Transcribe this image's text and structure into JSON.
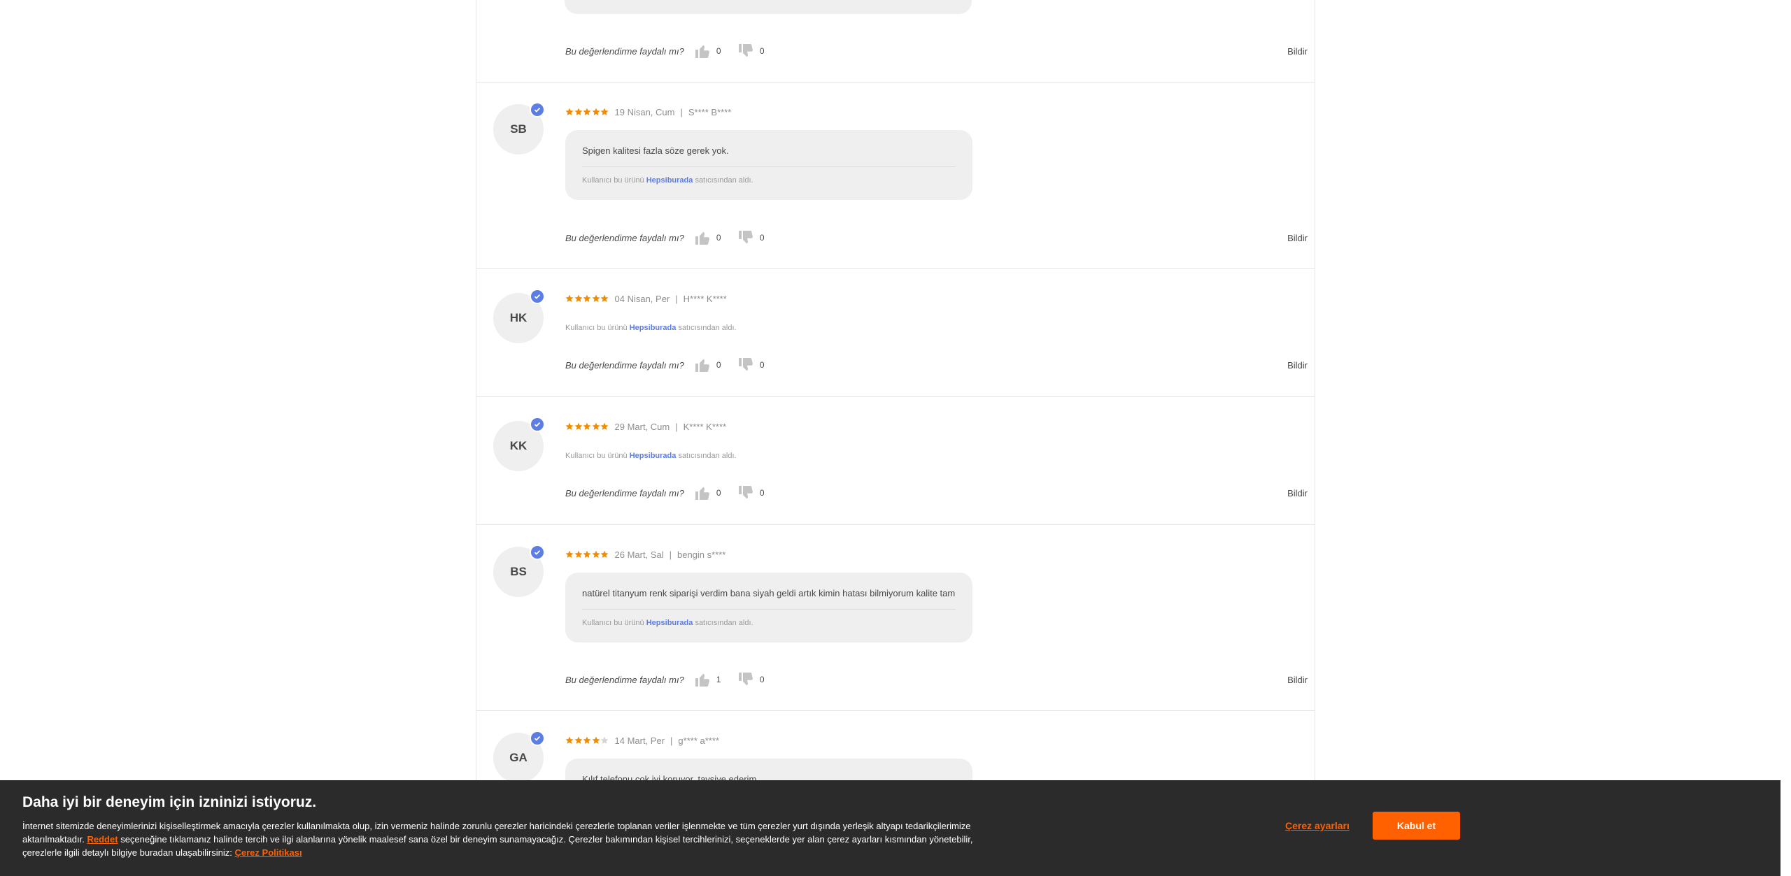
{
  "colors": {
    "accent": "#ff6000",
    "star": "#f28b00",
    "verified": "#5d7de6",
    "bubble": "#efefef",
    "banner": "#2b2b2b"
  },
  "common": {
    "helpful_question": "Bu değerlendirme faydalı mı?",
    "report": "Bildir",
    "seller_prefix": "Kullanıcı bu ürünü",
    "seller_name": "Hepsiburada",
    "seller_suffix": "satıcısından aldı."
  },
  "top_review": {
    "likes": "0",
    "dislikes": "0"
  },
  "reviews": [
    {
      "initials": "SB",
      "rating": 5,
      "date": "19 Nisan, Cum",
      "user": "S**** B****",
      "comment": "Spigen kalitesi fazla söze gerek yok.",
      "likes": "0",
      "dislikes": "0"
    },
    {
      "initials": "HK",
      "rating": 5,
      "date": "04 Nisan, Per",
      "user": "H**** K****",
      "comment": "",
      "likes": "0",
      "dislikes": "0"
    },
    {
      "initials": "KK",
      "rating": 5,
      "date": "29 Mart, Cum",
      "user": "K**** K****",
      "comment": "",
      "likes": "0",
      "dislikes": "0"
    },
    {
      "initials": "BS",
      "rating": 5,
      "date": "26 Mart, Sal",
      "user": "bengin s****",
      "comment": "natürel titanyum renk siparişi verdim bana siyah geldi artık kimin hatası bilmiyorum kalite tam",
      "likes": "1",
      "dislikes": "0"
    },
    {
      "initials": "GA",
      "rating": 4,
      "date": "14 Mart, Per",
      "user": "g**** a****",
      "comment": "Kılıf telefonu çok iyi koruyor, tavsiye ederim"
    }
  ],
  "cookie_banner": {
    "title": "Daha iyi bir deneyim için izninizi istiyoruz.",
    "text_part1": "İnternet sitemizde deneyimlerinizi kişiselleştirmek amacıyla çerezler kullanılmakta olup, izin vermeniz halinde zorunlu çerezler haricindeki çerezlerle toplanan veriler işlenmekte ve tüm çerezler yurt dışında yerleşik altyapı tedarikçilerimize aktarılmaktadır.",
    "reject_link": "Reddet",
    "text_part2": "seçeneğine tıklamanız halinde tercih ve ilgi alanlarına yönelik maalesef sana özel bir deneyim sunamayacağız. Çerezler bakımından kişisel tercihlerinizi, seçeneklerde yer alan çerez ayarları kısmından yönetebilir, çerezlerle ilgili detaylı bilgiye buradan ulaşabilirsiniz:",
    "policy_link": "Çerez Politikası",
    "settings_label": "Çerez ayarları",
    "accept_label": "Kabul et"
  }
}
